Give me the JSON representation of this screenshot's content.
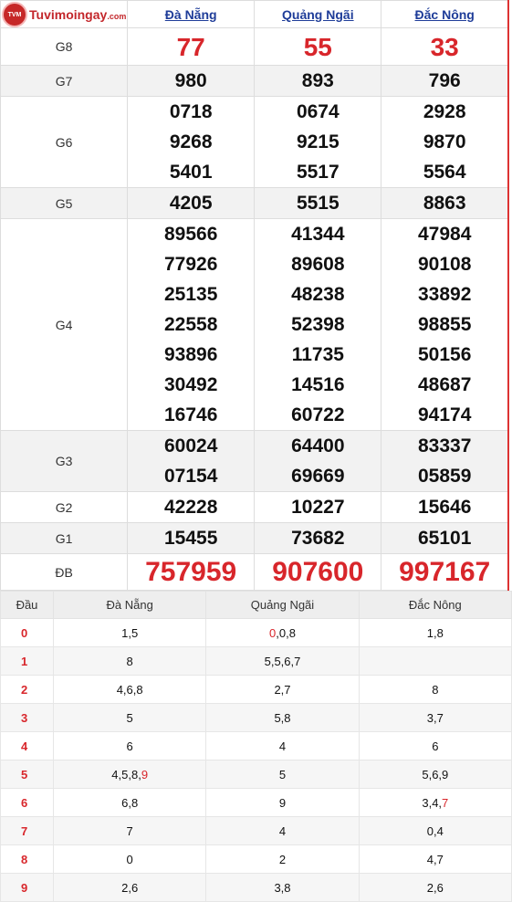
{
  "logo": {
    "text": "Tuvimoingay",
    "suffix": ".com",
    "badge": "TVM"
  },
  "provinces": [
    "Đà Nẵng",
    "Quảng Ngãi",
    "Đắc Nông"
  ],
  "prizes": [
    {
      "label": "G8",
      "values": [
        [
          "77"
        ],
        [
          "55"
        ],
        [
          "33"
        ]
      ]
    },
    {
      "label": "G7",
      "values": [
        [
          "980"
        ],
        [
          "893"
        ],
        [
          "796"
        ]
      ]
    },
    {
      "label": "G6",
      "values": [
        [
          "0718",
          "9268",
          "5401"
        ],
        [
          "0674",
          "9215",
          "5517"
        ],
        [
          "2928",
          "9870",
          "5564"
        ]
      ]
    },
    {
      "label": "G5",
      "values": [
        [
          "4205"
        ],
        [
          "5515"
        ],
        [
          "8863"
        ]
      ]
    },
    {
      "label": "G4",
      "values": [
        [
          "89566",
          "77926",
          "25135",
          "22558",
          "93896",
          "30492",
          "16746"
        ],
        [
          "41344",
          "89608",
          "48238",
          "52398",
          "11735",
          "14516",
          "60722"
        ],
        [
          "47984",
          "90108",
          "33892",
          "98855",
          "50156",
          "48687",
          "94174"
        ]
      ]
    },
    {
      "label": "G3",
      "values": [
        [
          "60024",
          "07154"
        ],
        [
          "64400",
          "69669"
        ],
        [
          "83337",
          "05859"
        ]
      ]
    },
    {
      "label": "G2",
      "values": [
        [
          "42228"
        ],
        [
          "10227"
        ],
        [
          "15646"
        ]
      ]
    },
    {
      "label": "G1",
      "values": [
        [
          "15455"
        ],
        [
          "73682"
        ],
        [
          "65101"
        ]
      ]
    },
    {
      "label": "ĐB",
      "values": [
        [
          "757959"
        ],
        [
          "907600"
        ],
        [
          "997167"
        ]
      ]
    }
  ],
  "dau_header": "Đầu",
  "dau_rows": [
    {
      "k": "0",
      "c": [
        [
          {
            "t": "1,5"
          }
        ],
        [
          {
            "t": "0",
            "red": true
          },
          {
            "t": ",0,8"
          }
        ],
        [
          {
            "t": "1,8"
          }
        ]
      ]
    },
    {
      "k": "1",
      "c": [
        [
          {
            "t": "8"
          }
        ],
        [
          {
            "t": "5,5,6,7"
          }
        ],
        [
          {
            "t": ""
          }
        ]
      ]
    },
    {
      "k": "2",
      "c": [
        [
          {
            "t": "4,6,8"
          }
        ],
        [
          {
            "t": "2,7"
          }
        ],
        [
          {
            "t": "8"
          }
        ]
      ]
    },
    {
      "k": "3",
      "c": [
        [
          {
            "t": "5"
          }
        ],
        [
          {
            "t": "5,8"
          }
        ],
        [
          {
            "t": "3,7"
          }
        ]
      ]
    },
    {
      "k": "4",
      "c": [
        [
          {
            "t": "6"
          }
        ],
        [
          {
            "t": "4"
          }
        ],
        [
          {
            "t": "6"
          }
        ]
      ]
    },
    {
      "k": "5",
      "c": [
        [
          {
            "t": "4,5,8,"
          },
          {
            "t": "9",
            "red": true
          }
        ],
        [
          {
            "t": "5"
          }
        ],
        [
          {
            "t": "5,6,9"
          }
        ]
      ]
    },
    {
      "k": "6",
      "c": [
        [
          {
            "t": "6,8"
          }
        ],
        [
          {
            "t": "9"
          }
        ],
        [
          {
            "t": "3,4,"
          },
          {
            "t": "7",
            "red": true
          }
        ]
      ]
    },
    {
      "k": "7",
      "c": [
        [
          {
            "t": "7"
          }
        ],
        [
          {
            "t": "4"
          }
        ],
        [
          {
            "t": "0,4"
          }
        ]
      ]
    },
    {
      "k": "8",
      "c": [
        [
          {
            "t": "0"
          }
        ],
        [
          {
            "t": "2"
          }
        ],
        [
          {
            "t": "4,7"
          }
        ]
      ]
    },
    {
      "k": "9",
      "c": [
        [
          {
            "t": "2,6"
          }
        ],
        [
          {
            "t": "3,8"
          }
        ],
        [
          {
            "t": "2,6"
          }
        ]
      ]
    }
  ]
}
